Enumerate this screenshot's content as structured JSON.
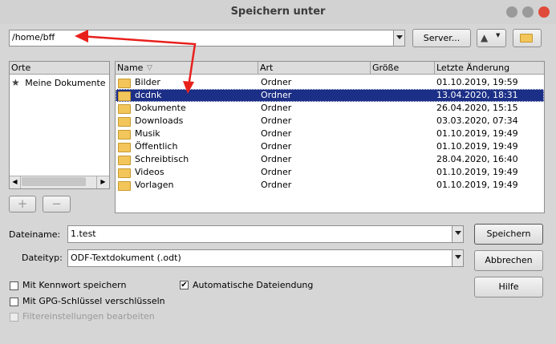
{
  "window": {
    "title": "Speichern unter"
  },
  "toolbar": {
    "path_value": "/home/bff",
    "server_label": "Server...",
    "up_icon": "▲",
    "up_dropdown_icon": "▼"
  },
  "places": {
    "header": "Orte",
    "items": [
      {
        "label": "Meine Dokumente",
        "icon": "★"
      }
    ],
    "scroll_left": "◀",
    "scroll_right": "▶",
    "add_label": "+",
    "remove_label": "−"
  },
  "files": {
    "columns": {
      "name": "Name",
      "type": "Art",
      "size": "Größe",
      "date": "Letzte Änderung"
    },
    "sort_indicator": "▽",
    "rows": [
      {
        "name": "Bilder",
        "type": "Ordner",
        "size": "",
        "date": "01.10.2019, 19:59"
      },
      {
        "name": "dcdnk",
        "type": "Ordner",
        "size": "",
        "date": "13.04.2020, 18:31",
        "selected": true
      },
      {
        "name": "Dokumente",
        "type": "Ordner",
        "size": "",
        "date": "26.04.2020, 15:15"
      },
      {
        "name": "Downloads",
        "type": "Ordner",
        "size": "",
        "date": "03.03.2020, 07:34"
      },
      {
        "name": "Musik",
        "type": "Ordner",
        "size": "",
        "date": "01.10.2019, 19:49"
      },
      {
        "name": "Öffentlich",
        "type": "Ordner",
        "size": "",
        "date": "01.10.2019, 19:49"
      },
      {
        "name": "Schreibtisch",
        "type": "Ordner",
        "size": "",
        "date": "28.04.2020, 16:40"
      },
      {
        "name": "Videos",
        "type": "Ordner",
        "size": "",
        "date": "01.10.2019, 19:49"
      },
      {
        "name": "Vorlagen",
        "type": "Ordner",
        "size": "",
        "date": "01.10.2019, 19:49"
      }
    ]
  },
  "form": {
    "filename_label": "Dateiname:",
    "filename_value": "1.test",
    "filetype_label": "Dateityp:",
    "filetype_value": "ODF-Textdokument (.odt)"
  },
  "buttons": {
    "save": "Speichern",
    "cancel": "Abbrechen",
    "help": "Hilfe"
  },
  "options": {
    "password": {
      "label": "Mit Kennwort speichern",
      "checked": false
    },
    "auto_extension": {
      "label": "Automatische Dateiendung",
      "checked": true,
      "mark": "✔"
    },
    "gpg": {
      "label": "Mit GPG-Schlüssel verschlüsseln",
      "checked": false
    },
    "filter": {
      "label": "Filtereinstellungen bearbeiten",
      "checked": false,
      "disabled": true
    }
  },
  "colors": {
    "selection": "#1c2f86",
    "arrow": "#e8201c",
    "close_button": "#e04a3b"
  }
}
